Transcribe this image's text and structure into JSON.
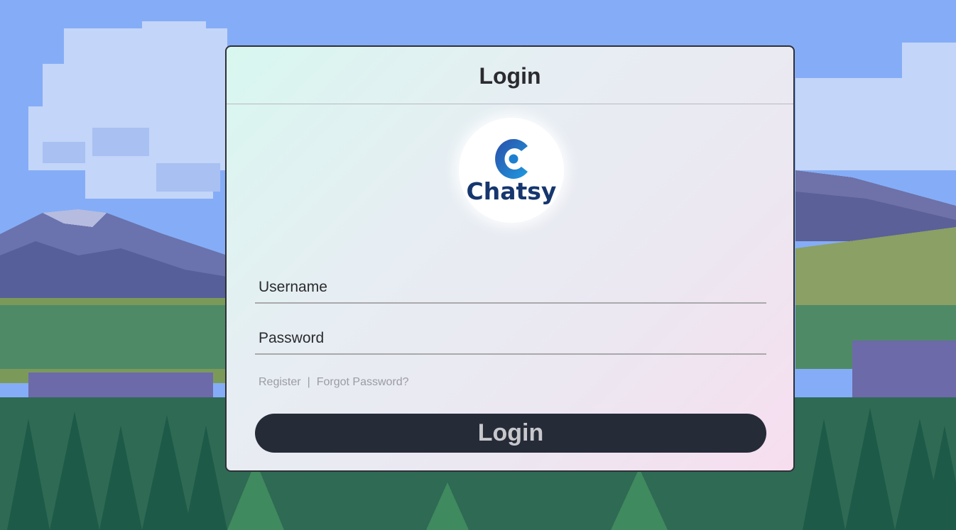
{
  "page": {
    "title": "Login"
  },
  "logo": {
    "text": "Chatsy",
    "icon": "chatsy-c-icon",
    "colors": {
      "text": "#16366e",
      "gradient_start": "#2b4ea8",
      "gradient_end": "#1e9ae0"
    }
  },
  "form": {
    "username": {
      "placeholder": "Username",
      "value": ""
    },
    "password": {
      "placeholder": "Password",
      "value": ""
    },
    "links": {
      "register": "Register",
      "separator": "|",
      "forgot": "Forgot Password?"
    },
    "submit_label": "Login"
  },
  "colors": {
    "button_bg": "#262b38",
    "button_text": "#c8c8cc",
    "sky": "#85adf7"
  }
}
